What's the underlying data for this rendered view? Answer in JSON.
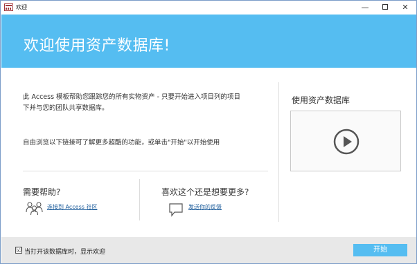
{
  "window": {
    "title": "欢迎",
    "controls": {
      "minimize": "—",
      "close": "✕"
    }
  },
  "banner": {
    "heading": "欢迎使用资产数据库!",
    "color": "#55bdf1"
  },
  "main": {
    "description": "此 Access 模板帮助您跟踪您的所有实物资产 - 只要开始进入项目列的项目下并与您的团队共享数据库。",
    "description_line1": "此 Access 模板帮助您跟踪您的所有实物资产 - 只要开始进入项目列的项目",
    "description_line2": "下并与您的团队共享数据库。",
    "explore": "自由浏览以下链接可了解更多超酷的功能，或单击\"开始\"以开始使用"
  },
  "help": {
    "title": "需要帮助?",
    "icon": "users-icon",
    "link": "连接到 Access 社区"
  },
  "more": {
    "title": "喜欢这个还是想要更多?",
    "icon": "speech-bubble-icon",
    "link": "发送你的反馈"
  },
  "video": {
    "title": "使用资产数据库",
    "icon": "play-icon"
  },
  "footer": {
    "checkbox_checked": "☑",
    "checkbox_label": "当打开该数据库时，显示欢迎",
    "start_label": "开始"
  }
}
